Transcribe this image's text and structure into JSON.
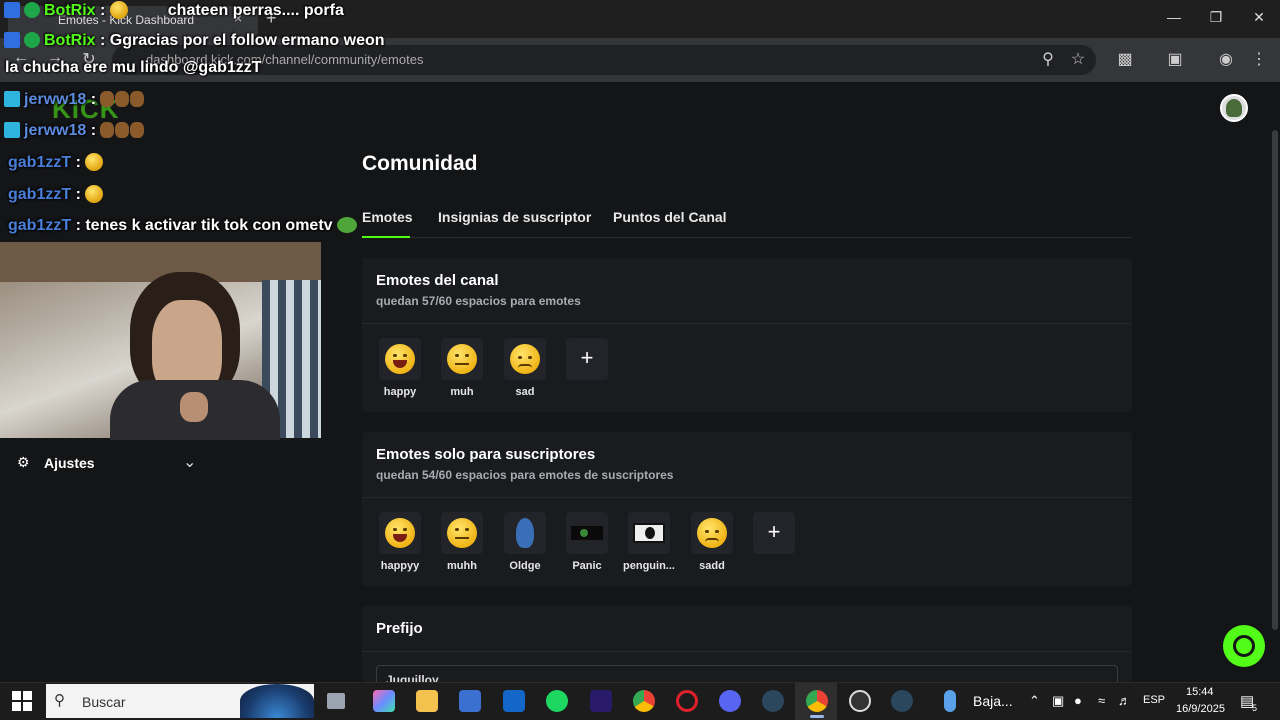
{
  "browser": {
    "tab_title": "Emotes - Kick Dashboard",
    "url": "dashboard.kick.com/channel/community/emotes",
    "new_tab": "+",
    "close_tab": "×"
  },
  "page": {
    "title": "Comunidad",
    "tabs": [
      {
        "label": "Emotes",
        "active": true
      },
      {
        "label": "Insignias de suscriptor",
        "active": false
      },
      {
        "label": "Puntos del Canal",
        "active": false
      }
    ],
    "channel_emotes": {
      "title": "Emotes del canal",
      "subtitle": "quedan 57/60 espacios para emotes",
      "items": [
        "happy",
        "muh",
        "sad"
      ],
      "add_label": "+"
    },
    "sub_emotes": {
      "title": "Emotes solo para suscriptores",
      "subtitle": "quedan 54/60 espacios para emotes de suscriptores",
      "items": [
        "happyy",
        "muhh",
        "Oldge",
        "Panic",
        "penguin...",
        "sadd"
      ],
      "add_label": "+"
    },
    "prefix": {
      "title": "Prefijo",
      "value": "Juquilloy"
    },
    "accent": "#53fc18"
  },
  "sidebar": {
    "logo": "KICK",
    "settings_label": "Ajustes"
  },
  "chat": [
    {
      "user": "BotRix",
      "sep": " : ",
      "message": "chateen perras.... porfa"
    },
    {
      "user": "BotRix",
      "sep": " : ",
      "message": "Ggracias por el follow ermano weon"
    },
    {
      "user": "",
      "sep": "",
      "message": "la chucha ere mu lindo @gab1zzT"
    },
    {
      "user": "jerww18",
      "sep": " : ",
      "message": ""
    },
    {
      "user": "jerww18",
      "sep": " : ",
      "message": ""
    },
    {
      "user": "gab1zzT",
      "sep": " : ",
      "message": ""
    },
    {
      "user": "gab1zzT",
      "sep": " : ",
      "message": ""
    },
    {
      "user": "gab1zzT",
      "sep": " : ",
      "message": "tenes k activar tik tok con ometv"
    }
  ],
  "taskbar": {
    "search_placeholder": "Buscar",
    "tray_label": "Baja...",
    "language": "ESP",
    "time": "15:44",
    "date": "16/9/2025",
    "notifications": "5"
  }
}
